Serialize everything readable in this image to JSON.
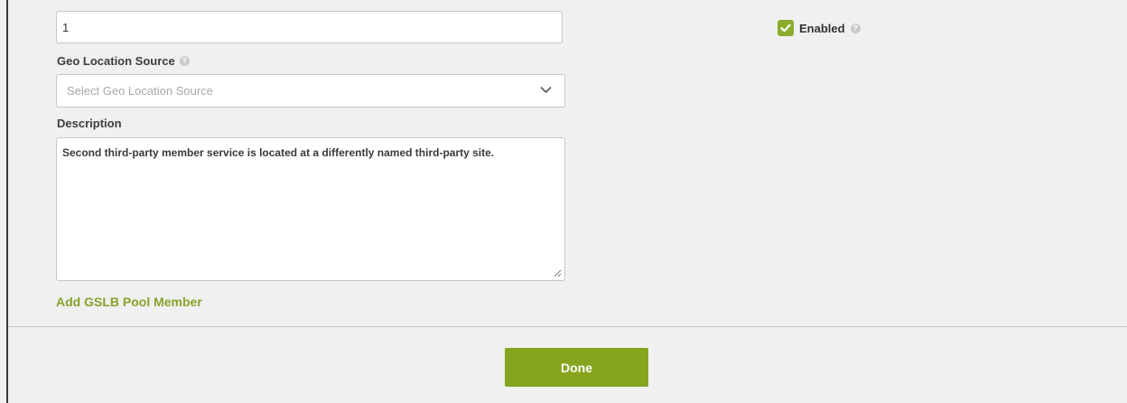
{
  "form": {
    "priority_value": "1",
    "geo_location_source": {
      "label": "Geo Location Source",
      "placeholder": "Select Geo Location Source"
    },
    "description": {
      "label": "Description",
      "value": "Second third-party member service is located at a differently named third-party site."
    },
    "add_member_link": "Add GSLB Pool Member",
    "enabled": {
      "label": "Enabled",
      "checked": true
    }
  },
  "footer": {
    "done_label": "Done"
  },
  "colors": {
    "accent": "#86a51f",
    "link": "#85a32a",
    "checkbox": "#8aac2b",
    "background": "#f0f0f0"
  },
  "icons": {
    "help": "help-icon",
    "dropdown": "chevron-down-icon",
    "check": "check-icon",
    "resize": "resize-grip-icon"
  }
}
